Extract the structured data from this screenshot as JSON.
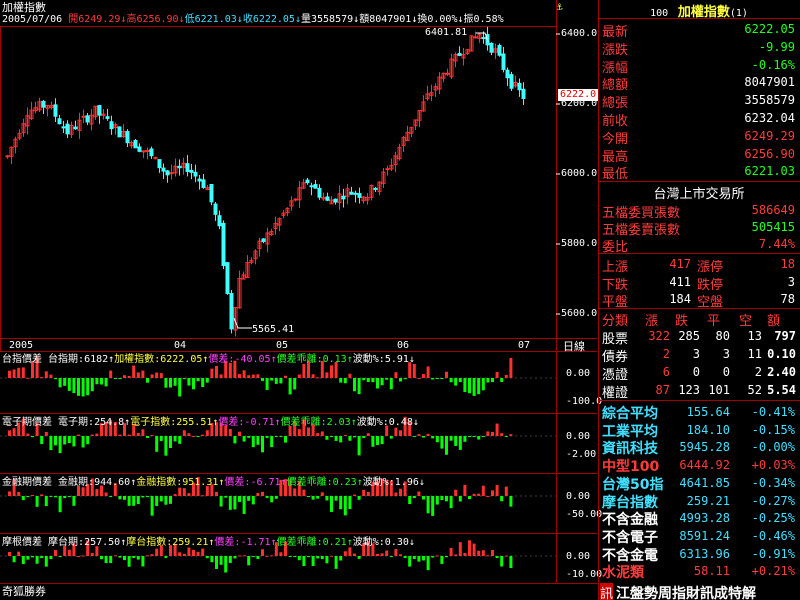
{
  "window": {
    "title": "加權指數",
    "footer": "奇狐勝券"
  },
  "colors": {
    "up": "#ff3030",
    "down": "#00ff00",
    "candle_up": "#ff3030",
    "candle_down": "#40ffff",
    "border": "#a00000"
  },
  "header": {
    "date": "2005/07/06",
    "open_label": "開",
    "open": "6249.29",
    "high_label": "高",
    "high": "6256.90",
    "low_label": "低",
    "low": "6221.03",
    "close_label": "收",
    "close": "6222.05",
    "vol_label": "量",
    "vol": "3558579",
    "amt_label": "額",
    "amt": "8047901",
    "turn_label": "換",
    "turn": "0.00%",
    "amp_label": "振",
    "amp": "0.58%"
  },
  "main_chart": {
    "price_ticks": [
      "6400.0",
      "6200.0",
      "6000.0",
      "5800.0",
      "5600.0"
    ],
    "high_mark": "6401.81",
    "low_mark": "5565.41",
    "last_price_tag": "6222.0",
    "month_labels": [
      "2005",
      "04",
      "05",
      "06",
      "07"
    ],
    "period_label": "日線"
  },
  "sub_panels": [
    {
      "name": "台指價差",
      "fut_label": "台指期",
      "fut": "6182",
      "idx_label": "加權指數",
      "idx": "6222.05",
      "spread_label": "價差",
      "spread": "-40.05",
      "dev_label": "價差乖離",
      "dev": "0.13",
      "vol_label": "波動%",
      "vol": "5.91",
      "ticks": [
        "0.00",
        "-100.0"
      ]
    },
    {
      "name": "電子期價差",
      "fut_label": "電子期",
      "fut": "254.8",
      "idx_label": "電子指數",
      "idx": "255.51",
      "spread_label": "價差",
      "spread": "-0.71",
      "dev_label": "價差乖離",
      "dev": "2.03",
      "vol_label": "波動%",
      "vol": "0.48",
      "ticks": [
        "0.00",
        "-2.00"
      ]
    },
    {
      "name": "金融期價差",
      "fut_label": "金融期",
      "fut": "944.60",
      "idx_label": "金融指數",
      "idx": "951.31",
      "spread_label": "價差",
      "spread": "-6.71",
      "dev_label": "價差乖離",
      "dev": "0.23",
      "vol_label": "波動%",
      "vol": "1.96",
      "ticks": [
        "0.00",
        "-50.00"
      ]
    },
    {
      "name": "摩根價差",
      "fut_label": "摩台期",
      "fut": "257.50",
      "idx_label": "摩台指數",
      "idx": "259.21",
      "spread_label": "價差",
      "spread": "-1.71",
      "dev_label": "價差乖離",
      "dev": "0.21",
      "vol_label": "波動%",
      "vol": "0.30",
      "ticks": [
        "0.00",
        "-10.00"
      ]
    }
  ],
  "quote": {
    "code": "100",
    "name": "加權指數",
    "tag": "(1)",
    "rows": [
      {
        "label": "最新",
        "value": "6222.05",
        "color": "grn"
      },
      {
        "label": "漲跌",
        "value": "-9.99",
        "color": "grn"
      },
      {
        "label": "漲幅",
        "value": "-0.16%",
        "color": "grn"
      },
      {
        "label": "總額",
        "value": "8047901",
        "color": "wht"
      },
      {
        "label": "總張",
        "value": "3558579",
        "color": "wht"
      },
      {
        "label": "前收",
        "value": "6232.04",
        "color": "wht"
      },
      {
        "label": "今開",
        "value": "6249.29",
        "color": "red"
      },
      {
        "label": "最高",
        "value": "6256.90",
        "color": "red"
      },
      {
        "label": "最低",
        "value": "6221.03",
        "color": "grn"
      }
    ]
  },
  "exchange": {
    "title": "台灣上市交易所",
    "rows": [
      {
        "label": "五檔委買張數",
        "value": "586649",
        "color": "red"
      },
      {
        "label": "五檔委賣張數",
        "value": "505415",
        "color": "grn"
      },
      {
        "label": "委比",
        "value": "7.44%",
        "color": "red"
      }
    ]
  },
  "breadth": {
    "rows": [
      {
        "l1": "上漲",
        "v1": "417",
        "c1": "red",
        "l2": "漲停",
        "v2": "18",
        "c2": "red"
      },
      {
        "l1": "下跌",
        "v1": "411",
        "c1": "wht",
        "l2": "跌停",
        "v2": "3",
        "c2": "wht"
      },
      {
        "l1": "平盤",
        "v1": "184",
        "c1": "wht",
        "l2": "空盤",
        "v2": "78",
        "c2": "wht"
      }
    ]
  },
  "category": {
    "headers": [
      "分類",
      "漲",
      "跌",
      "平",
      "空",
      "額"
    ],
    "rows": [
      {
        "name": "股票",
        "up": "322",
        "down": "285",
        "flat": "80",
        "none": "13",
        "amt": "797"
      },
      {
        "name": "債券",
        "up": "2",
        "down": "3",
        "flat": "3",
        "none": "11",
        "amt": "0.10"
      },
      {
        "name": "憑證",
        "up": "6",
        "down": "0",
        "flat": "0",
        "none": "2",
        "amt": "2.40"
      },
      {
        "name": "權證",
        "up": "87",
        "down": "123",
        "flat": "101",
        "none": "52",
        "amt": "5.54"
      }
    ]
  },
  "indices": {
    "rows": [
      {
        "name": "綜合平均",
        "value": "155.64",
        "chg": "-0.41%",
        "nc": "cyn",
        "vc": "cyn",
        "cc": "cyn"
      },
      {
        "name": "工業平均",
        "value": "184.10",
        "chg": "-0.15%",
        "nc": "cyn",
        "vc": "cyn",
        "cc": "cyn"
      },
      {
        "name": "資訊科技",
        "value": "5945.28",
        "chg": "-0.00%",
        "nc": "cyn",
        "vc": "cyn",
        "cc": "cyn"
      },
      {
        "name": "中型100",
        "value": "6444.92",
        "chg": "+0.03%",
        "nc": "red",
        "vc": "red",
        "cc": "red"
      },
      {
        "name": "台灣50指",
        "value": "4641.85",
        "chg": "-0.34%",
        "nc": "cyn",
        "vc": "cyn",
        "cc": "cyn"
      },
      {
        "name": "摩台指數",
        "value": "259.21",
        "chg": "-0.27%",
        "nc": "cyn",
        "vc": "cyn",
        "cc": "cyn"
      },
      {
        "name": "不含金融",
        "value": "4993.28",
        "chg": "-0.25%",
        "nc": "wht",
        "vc": "cyn",
        "cc": "cyn"
      },
      {
        "name": "不含電子",
        "value": "8591.24",
        "chg": "-0.46%",
        "nc": "wht",
        "vc": "cyn",
        "cc": "cyn"
      },
      {
        "name": "不含金電",
        "value": "6313.96",
        "chg": "-0.91%",
        "nc": "wht",
        "vc": "cyn",
        "cc": "cyn"
      },
      {
        "name": "水泥類",
        "value": "58.11",
        "chg": "+0.21%",
        "nc": "red",
        "vc": "red",
        "cc": "red"
      }
    ]
  },
  "ticker": {
    "badge": "訊",
    "text": "江盤勢周指財訊成特解"
  }
}
